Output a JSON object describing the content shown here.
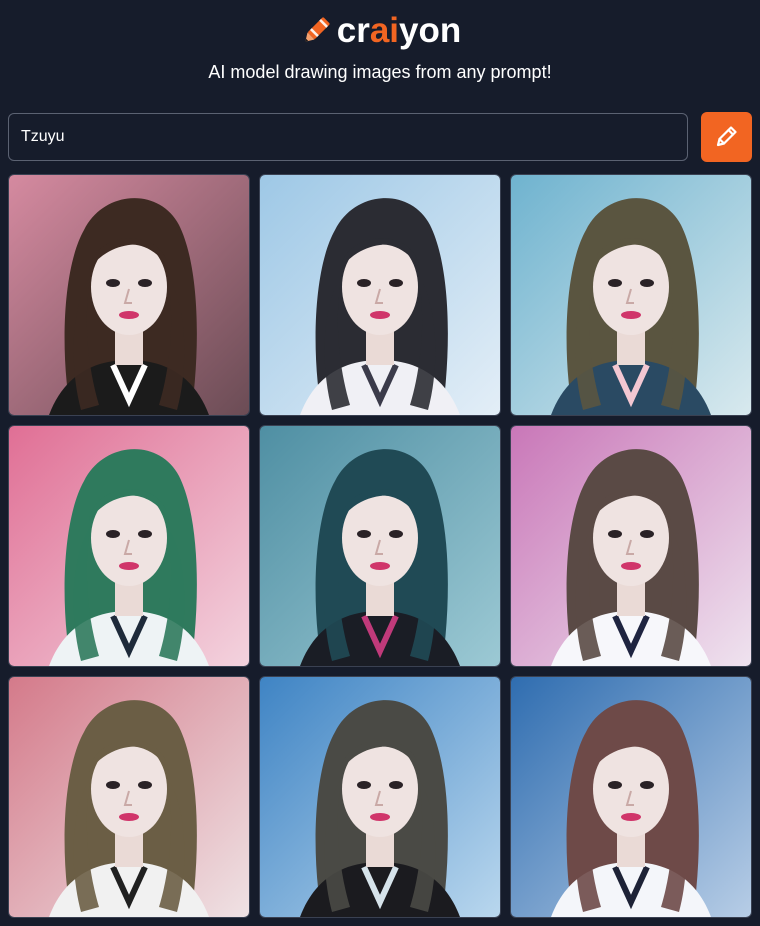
{
  "brand": {
    "prefix": "cr",
    "accent": "ai",
    "suffix": "yon",
    "logo_icon": "crayon-pencil-icon",
    "accent_color": "#f26522"
  },
  "tagline": "AI model drawing images from any prompt!",
  "prompt": {
    "value": "Tzuyu",
    "button_icon": "pencil-icon",
    "button_color": "#f26522"
  },
  "colors": {
    "background": "#161c2b",
    "input_border": "#5b6272"
  },
  "results": [
    {
      "bg1": "#d58aa0",
      "bg2": "#6b4c55",
      "hair": "#3d2a22",
      "shirt": "#1b1b1b",
      "collar": "#ffffff"
    },
    {
      "bg1": "#9ec8e6",
      "bg2": "#e3eef7",
      "hair": "#2b2c33",
      "shirt": "#f0f0f5",
      "collar": "#3b3b4a"
    },
    {
      "bg1": "#6fb3cf",
      "bg2": "#d8e9ee",
      "hair": "#5a5540",
      "shirt": "#2a4a63",
      "collar": "#f3c7d2"
    },
    {
      "bg1": "#e06f95",
      "bg2": "#f3d3de",
      "hair": "#2f7a5d",
      "shirt": "#eef3f5",
      "collar": "#1e2a3a"
    },
    {
      "bg1": "#4f8fa3",
      "bg2": "#9cc9d4",
      "hair": "#204a55",
      "shirt": "#1a1d25",
      "collar": "#c03a7a"
    },
    {
      "bg1": "#c977b8",
      "bg2": "#efe3ef",
      "hair": "#5a4a45",
      "shirt": "#f7f7fb",
      "collar": "#1f2440"
    },
    {
      "bg1": "#d47a8a",
      "bg2": "#efe2e4",
      "hair": "#6b5e45",
      "shirt": "#f1f1f1",
      "collar": "#202020"
    },
    {
      "bg1": "#3f84c4",
      "bg2": "#b9d7ee",
      "hair": "#4a4a45",
      "shirt": "#1b1b1f",
      "collar": "#d6e3ea"
    },
    {
      "bg1": "#2f6db0",
      "bg2": "#b7cde6",
      "hair": "#6e4a48",
      "shirt": "#f4f6fa",
      "collar": "#1d2236"
    }
  ]
}
